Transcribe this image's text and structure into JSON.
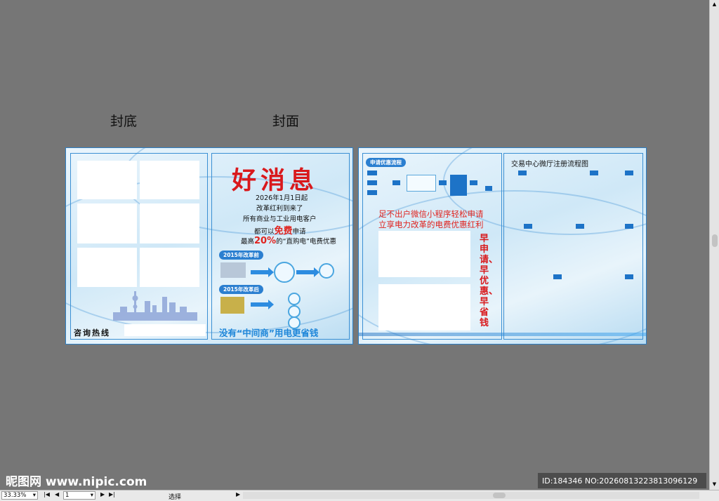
{
  "labels": {
    "back_cover": "封底",
    "front_cover": "封面"
  },
  "back": {
    "hotline_label": "咨询热线"
  },
  "front": {
    "title": "好消息",
    "lines": [
      "2026年1月1日起",
      "改革红利到来了",
      "所有商业与工业用电客户"
    ],
    "free_prefix": "都可以",
    "free_word": "免费",
    "free_suffix": "申请",
    "discount_prefix": "最高",
    "discount_value": "20%",
    "discount_suffix": "的“直购电”电费优惠",
    "before_badge": "2015年改革前",
    "after_badge": "2015年改革后",
    "slogan": "没有“中间商”用电更省钱"
  },
  "inner_left": {
    "badge": "申请优惠流程",
    "red_line1": "足不出户微信小程序轻松申请",
    "red_line2": "立享电力改革的电费优惠红利",
    "vertical_text": "早申请、早优惠、早省钱"
  },
  "inner_right": {
    "title": "交易中心微厅注册流程图"
  },
  "watermark": {
    "site": "昵图网 www.nipic.com",
    "id": "ID:184346 NO:20260813223813096129"
  },
  "statusbar": {
    "zoom": "33.33%",
    "page": "1",
    "mode": "选择"
  },
  "colors": {
    "accent_red": "#d9191c",
    "accent_blue": "#2b7fd0",
    "background": "#767676"
  }
}
